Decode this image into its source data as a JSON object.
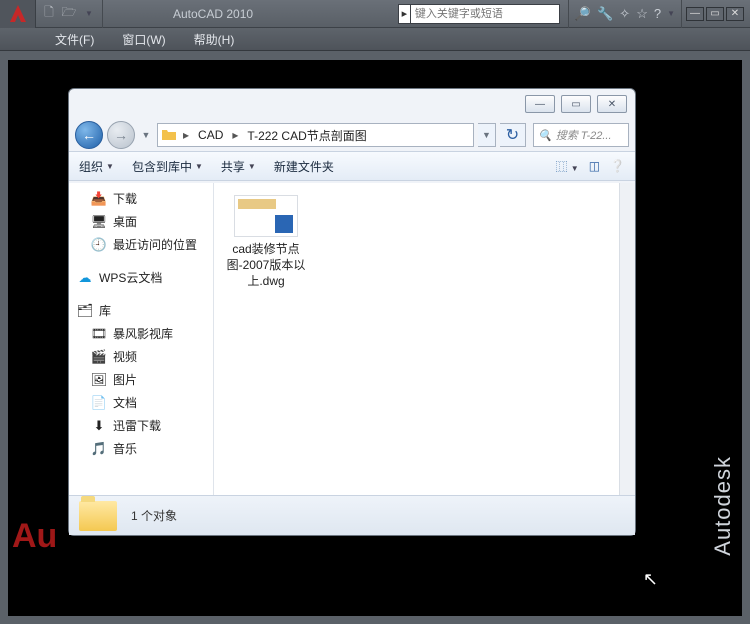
{
  "autocad": {
    "title": "AutoCAD 2010",
    "search_placeholder": "键入关键字或短语",
    "menu": {
      "file": "文件(F)",
      "window": "窗口(W)",
      "help": "帮助(H)"
    },
    "brand": "Autodesk",
    "corner": "Au"
  },
  "explorer": {
    "breadcrumb": {
      "seg1": "CAD",
      "seg2": "T-222 CAD节点剖面图"
    },
    "search_placeholder": "搜索 T-22...",
    "toolbar": {
      "organize": "组织",
      "include": "包含到库中",
      "share": "共享",
      "newfolder": "新建文件夹"
    },
    "sidebar": {
      "downloads": "下载",
      "desktop": "桌面",
      "recent": "最近访问的位置",
      "wps": "WPS云文档",
      "libraries": "库",
      "baofeng": "暴风影视库",
      "videos": "视频",
      "pictures": "图片",
      "documents": "文档",
      "xunlei": "迅雷下载",
      "music": "音乐"
    },
    "file": {
      "name": "cad装修节点图-2007版本以上.dwg"
    },
    "status": "1 个对象"
  }
}
